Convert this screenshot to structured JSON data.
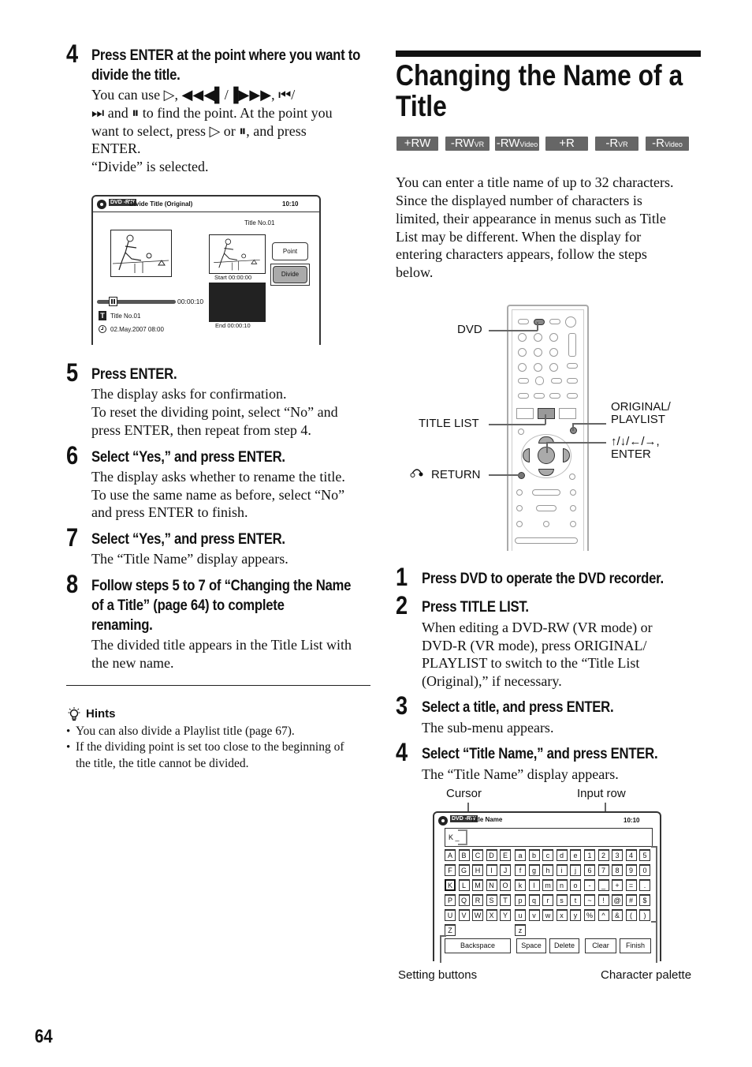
{
  "page_number": "64",
  "left": {
    "step4": {
      "num": "4",
      "heading_line1": "Press ENTER at the point where you want to",
      "heading_line2": "divide the title.",
      "body": [
        "You can use ▷, ◀◀◀▌/▐▶▶▶, ⏮/",
        "⏭ and ⏸ to find the point. At the point you",
        "want to select, press ▷ or ⏸, and press",
        "ENTER.",
        "“Divide” is selected."
      ]
    },
    "divide_screen": {
      "header_badge": "DVD -RW",
      "header_title": "Divide Title (Original)",
      "header_time": "10:10",
      "title_no_right": "Title No.01",
      "point_button": "Point",
      "divide_button": "Divide",
      "start_label": "Start  00:00:00",
      "end_label": "End   00:00:10",
      "timeline_time": "00:00:10",
      "timeline_progress": 0.1,
      "title_icon": "T",
      "title_no_left": "Title No.01",
      "date_time": "02.May.2007   08:00"
    },
    "step5": {
      "num": "5",
      "heading": "Press ENTER.",
      "body": [
        "The display asks for confirmation.",
        "To reset the dividing point, select “No” and",
        "press ENTER, then repeat from step 4."
      ]
    },
    "step6": {
      "num": "6",
      "heading": "Select “Yes,” and press ENTER.",
      "body": [
        "The display asks whether to rename the title.",
        "To use the same name as before, select “No”",
        "and press ENTER to finish."
      ]
    },
    "step7": {
      "num": "7",
      "heading": "Select “Yes,” and press ENTER.",
      "body": [
        "The “Title Name” display appears."
      ]
    },
    "step8": {
      "num": "8",
      "heading_lines": [
        "Follow steps 5 to 7 of “Changing the Name",
        "of a Title” (page 64) to complete",
        "renaming."
      ],
      "body": [
        "The divided title appears in the Title List with",
        "the new name."
      ]
    },
    "hints": {
      "title": "Hints",
      "items": [
        "You can also divide a Playlist title (page 67).",
        "If the dividing point is set too close to the beginning of",
        "the title, the title cannot be divided."
      ]
    }
  },
  "right": {
    "section_title_line1": "Changing the Name of a",
    "section_title_line2": "Title",
    "disc_badges": [
      {
        "main": "+RW",
        "sub": ""
      },
      {
        "main": "-RW",
        "sub": "VR"
      },
      {
        "main": "-RW",
        "sub": "Video"
      },
      {
        "main": "+R",
        "sub": ""
      },
      {
        "main": "-R",
        "sub": "VR"
      },
      {
        "main": "-R",
        "sub": "Video"
      }
    ],
    "intro": [
      "You can enter a title name of up to 32 characters.",
      "Since the displayed number of characters is",
      "limited, their appearance in menus such as Title",
      "List may be different. When the display for",
      "entering characters appears, follow the steps",
      "below."
    ],
    "remote_callouts": {
      "dvd": "DVD",
      "title_list": "TITLE LIST",
      "return": "RETURN",
      "original_playlist_1": "ORIGINAL/",
      "original_playlist_2": "PLAYLIST",
      "arrows_1": "↑/↓/←/→,",
      "arrows_2": "ENTER"
    },
    "steps": [
      {
        "num": "1",
        "heading": "Press DVD to operate the DVD recorder.",
        "body": []
      },
      {
        "num": "2",
        "heading": "Press TITLE LIST.",
        "body": [
          "When editing a DVD-RW (VR mode) or",
          "DVD-R (VR mode), press ORIGINAL/",
          "PLAYLIST to switch to the “Title List",
          "(Original),” if necessary."
        ]
      },
      {
        "num": "3",
        "heading": "Select a title, and press ENTER.",
        "body": [
          "The sub-menu appears."
        ]
      },
      {
        "num": "4",
        "heading": "Select “Title Name,” and press ENTER.",
        "body": [
          "The “Title Name” display appears."
        ]
      }
    ],
    "title_name_screen": {
      "callout_cursor": "Cursor",
      "callout_input_row": "Input row",
      "callout_setting_buttons": "Setting buttons",
      "callout_character_palette": "Character palette",
      "header_badge": "DVD -RW",
      "header_title": "Title Name",
      "header_time": "10:10",
      "input_value": "K _",
      "upper_rows": [
        [
          "A",
          "B",
          "C",
          "D",
          "E"
        ],
        [
          "F",
          "G",
          "H",
          "I",
          "J"
        ],
        [
          "K",
          "L",
          "M",
          "N",
          "O"
        ],
        [
          "P",
          "Q",
          "R",
          "S",
          "T"
        ],
        [
          "U",
          "V",
          "W",
          "X",
          "Y"
        ],
        [
          "Z"
        ]
      ],
      "lower_rows": [
        [
          "a",
          "b",
          "c",
          "d",
          "e"
        ],
        [
          "f",
          "g",
          "h",
          "i",
          "j"
        ],
        [
          "k",
          "l",
          "m",
          "n",
          "o"
        ],
        [
          "p",
          "q",
          "r",
          "s",
          "t"
        ],
        [
          "u",
          "v",
          "w",
          "x",
          "y"
        ],
        [
          "z"
        ]
      ],
      "symbol_rows": [
        [
          "1",
          "2",
          "3",
          "4",
          "5"
        ],
        [
          "6",
          "7",
          "8",
          "9",
          "0"
        ],
        [
          "-",
          "_",
          "+",
          "=",
          "."
        ],
        [
          "~",
          "!",
          "@",
          "#",
          "$"
        ],
        [
          "%",
          "^",
          "&",
          "(",
          ")"
        ]
      ],
      "selected_key": "K",
      "buttons": [
        "Backspace",
        "Space",
        "Delete",
        "Clear",
        "Finish"
      ]
    }
  }
}
